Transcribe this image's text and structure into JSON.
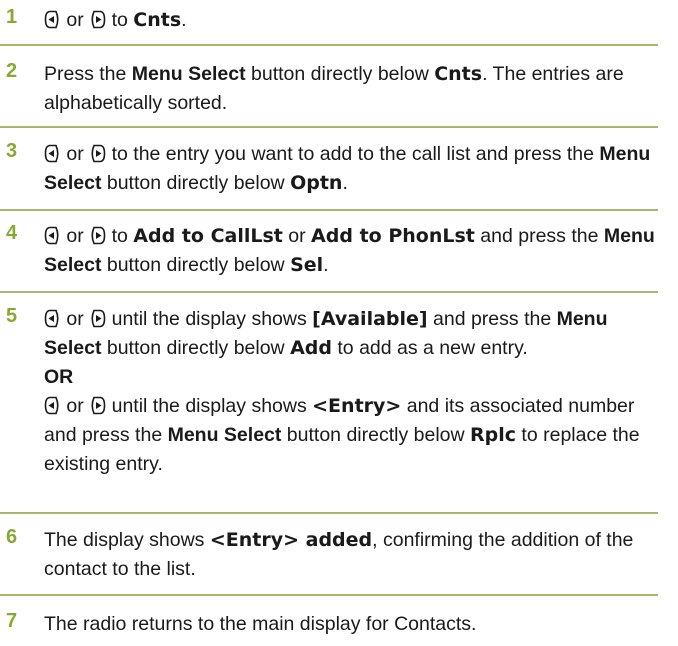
{
  "steps": [
    {
      "num": "1",
      "text": "{L} or {R} to [Cnts]."
    },
    {
      "num": "2",
      "text": "Press the *Menu Select* button directly below [Cnts]. The entries are alphabetically sorted."
    },
    {
      "num": "3",
      "text": "{L} or {R} to the entry you want to add to the call list and press the *Menu Select* button directly below [Optn]."
    },
    {
      "num": "4",
      "text": "{L} or {R} to [Add to CallLst] or [Add to PhonLst] and press the *Menu Select* button directly below [Sel]."
    },
    {
      "num": "5",
      "text": "{L} or {R} until the display shows [[Available]] and press the *Menu Select* button directly below [Add] to add as a new entry.|*OR*|{L} or {R} until the display shows [<Entry>] and its associated number and press the *Menu Select* button directly below [Rplc] to replace the existing entry."
    },
    {
      "num": "6",
      "text": "The display shows [<Entry> added], confirming the addition of the contact to the list."
    },
    {
      "num": "7",
      "text": "The radio returns to the main display for Contacts."
    }
  ],
  "colors": {
    "step_number": "#88a832",
    "rule": "#a8b86a",
    "text": "#1a1a1a"
  },
  "icons": {
    "L": "navigation-left-icon",
    "R": "navigation-right-icon"
  }
}
